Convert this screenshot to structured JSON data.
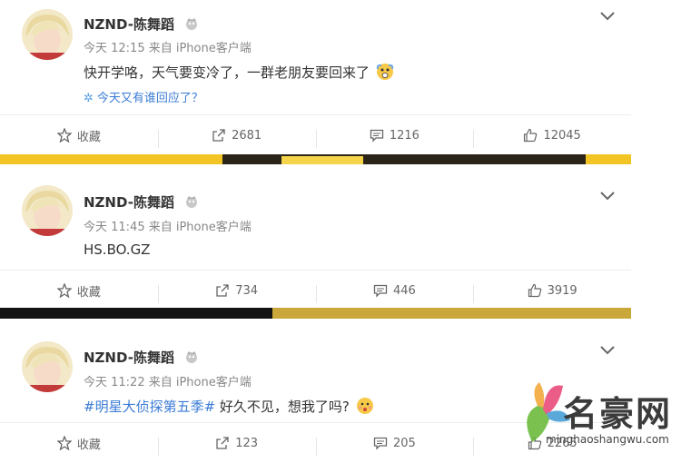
{
  "posts": [
    {
      "user": "NZND-陈舞蹈",
      "meta": "今天 12:15 来自 iPhone客户端",
      "content": "快开学咯，天气要变冷了，一群老朋友要回来了",
      "note": "今天又有谁回应了？",
      "actions": {
        "favorite": "收藏",
        "repost": "2681",
        "comment": "1216",
        "like": "12045"
      }
    },
    {
      "user": "NZND-陈舞蹈",
      "meta": "今天 11:45 来自 iPhone客户端",
      "content": "HS.BO.GZ",
      "actions": {
        "favorite": "收藏",
        "repost": "734",
        "comment": "446",
        "like": "3919"
      }
    },
    {
      "user": "NZND-陈舞蹈",
      "meta": "今天 11:22 来自 iPhone客户端",
      "hashtag": "#明星大侦探第五季#",
      "content": "好久不见，想我了吗?",
      "actions": {
        "favorite": "收藏",
        "repost": "123",
        "comment": "205",
        "like": "2265"
      }
    }
  ],
  "watermark": {
    "title": "名豪网",
    "url": "minghaoshangwu.com"
  },
  "colors": {
    "link": "#3a7bd5",
    "text": "#333333",
    "meta": "#888888"
  }
}
